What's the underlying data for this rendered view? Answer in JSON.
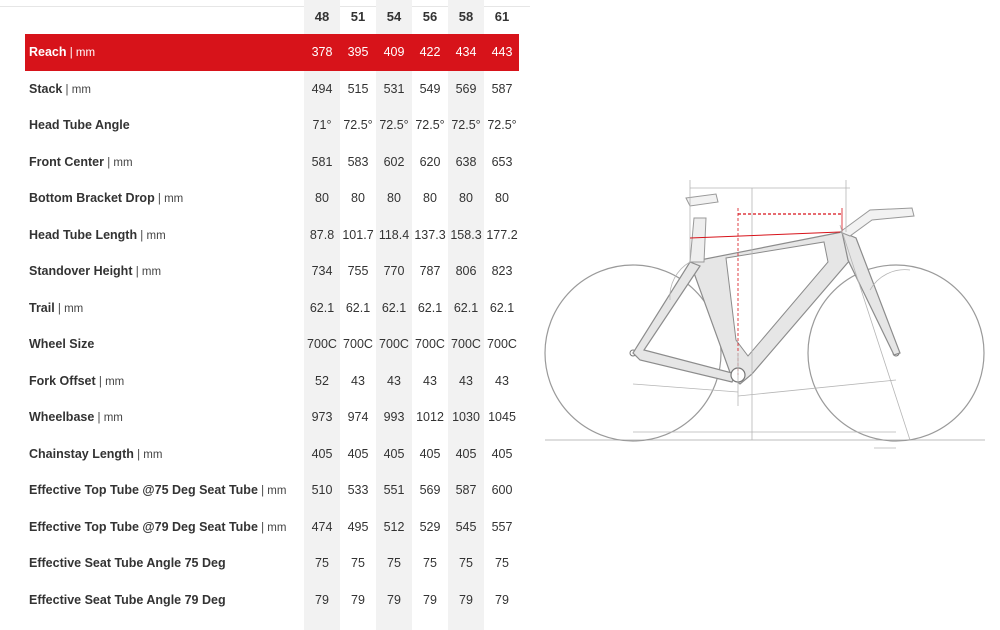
{
  "table": {
    "sizes": [
      "48",
      "51",
      "54",
      "56",
      "58",
      "61"
    ],
    "highlight_color": "#d7131a",
    "rows": [
      {
        "label": "Reach",
        "unit": " | mm",
        "values": [
          "378",
          "395",
          "409",
          "422",
          "434",
          "443"
        ],
        "active": true
      },
      {
        "label": "Stack",
        "unit": " | mm",
        "values": [
          "494",
          "515",
          "531",
          "549",
          "569",
          "587"
        ]
      },
      {
        "label": "Head Tube Angle",
        "unit": "",
        "values": [
          "71°",
          "72.5°",
          "72.5°",
          "72.5°",
          "72.5°",
          "72.5°"
        ]
      },
      {
        "label": "Front Center",
        "unit": " | mm",
        "values": [
          "581",
          "583",
          "602",
          "620",
          "638",
          "653"
        ]
      },
      {
        "label": "Bottom Bracket Drop",
        "unit": " | mm",
        "values": [
          "80",
          "80",
          "80",
          "80",
          "80",
          "80"
        ]
      },
      {
        "label": "Head Tube Length",
        "unit": " | mm",
        "values": [
          "87.8",
          "101.7",
          "118.4",
          "137.3",
          "158.3",
          "177.2"
        ]
      },
      {
        "label": "Standover Height",
        "unit": " | mm",
        "values": [
          "734",
          "755",
          "770",
          "787",
          "806",
          "823"
        ]
      },
      {
        "label": "Trail",
        "unit": " | mm",
        "values": [
          "62.1",
          "62.1",
          "62.1",
          "62.1",
          "62.1",
          "62.1"
        ]
      },
      {
        "label": "Wheel Size",
        "unit": "",
        "values": [
          "700C",
          "700C",
          "700C",
          "700C",
          "700C",
          "700C"
        ]
      },
      {
        "label": "Fork Offset",
        "unit": " | mm",
        "values": [
          "52",
          "43",
          "43",
          "43",
          "43",
          "43"
        ]
      },
      {
        "label": "Wheelbase",
        "unit": " | mm",
        "values": [
          "973",
          "974",
          "993",
          "1012",
          "1030",
          "1045"
        ]
      },
      {
        "label": "Chainstay Length",
        "unit": " | mm",
        "values": [
          "405",
          "405",
          "405",
          "405",
          "405",
          "405"
        ]
      },
      {
        "label": "Effective Top Tube @75 Deg Seat Tube",
        "unit": " | mm",
        "values": [
          "510",
          "533",
          "551",
          "569",
          "587",
          "600"
        ]
      },
      {
        "label": "Effective Top Tube @79 Deg Seat Tube",
        "unit": " | mm",
        "values": [
          "474",
          "495",
          "512",
          "529",
          "545",
          "557"
        ]
      },
      {
        "label": "Effective Seat Tube Angle 75 Deg",
        "unit": "",
        "values": [
          "75",
          "75",
          "75",
          "75",
          "75",
          "75"
        ]
      },
      {
        "label": "Effective Seat Tube Angle 79 Deg",
        "unit": "",
        "values": [
          "79",
          "79",
          "79",
          "79",
          "79",
          "79"
        ]
      }
    ]
  },
  "diagram": {
    "icon": "bike-geometry-diagram-icon",
    "frame_color": "#e3e3e3",
    "line_color": "#b5b5b5",
    "highlight_color": "#d7131a"
  }
}
